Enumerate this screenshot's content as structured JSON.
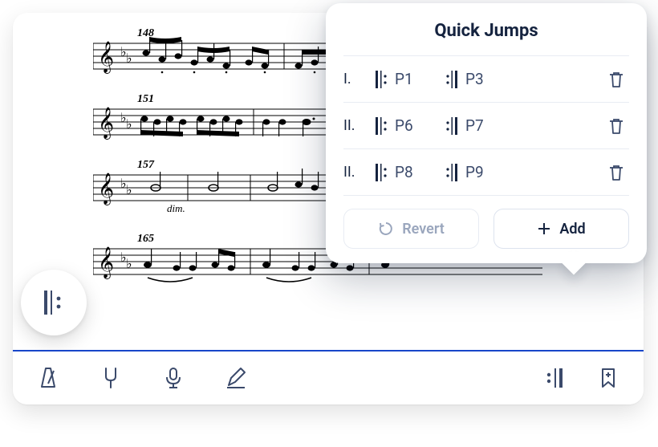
{
  "sheet": {
    "measures": [
      {
        "number": "148",
        "marking": ""
      },
      {
        "number": "151",
        "marking": ""
      },
      {
        "number": "157",
        "marking": "dim."
      },
      {
        "number": "165",
        "marking": ""
      }
    ]
  },
  "popover": {
    "title": "Quick Jumps",
    "rows": [
      {
        "ordinal": "I.",
        "from": "P1",
        "to": "P3"
      },
      {
        "ordinal": "II.",
        "from": "P6",
        "to": "P7"
      },
      {
        "ordinal": "II.",
        "from": "P8",
        "to": "P9"
      }
    ],
    "revert_label": "Revert",
    "add_label": "Add"
  },
  "toolbar": {
    "icons": {
      "metronome": "metronome",
      "tuning_fork": "tuning_fork",
      "mic": "mic",
      "pencil": "pencil",
      "jumps": "jumps",
      "bookmark": "bookmark"
    }
  }
}
